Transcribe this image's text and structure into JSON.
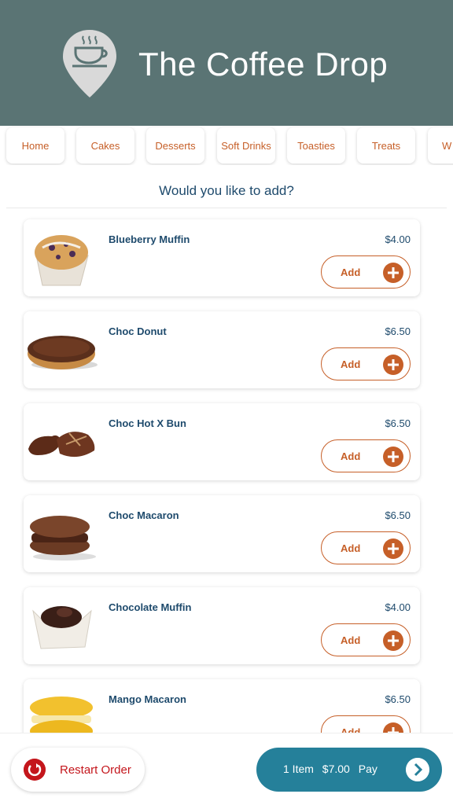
{
  "header": {
    "title": "The Coffee Drop",
    "logo": "coffee-map-pin-logo"
  },
  "tabs": [
    {
      "label": "Home"
    },
    {
      "label": "Cakes"
    },
    {
      "label": "Desserts"
    },
    {
      "label": "Soft Drinks"
    },
    {
      "label": "Toasties"
    },
    {
      "label": "Treats"
    },
    {
      "label": "W"
    }
  ],
  "section": {
    "title": "Would you like to add?"
  },
  "items": [
    {
      "name": "Blueberry Muffin",
      "price": "$4.00",
      "add_label": "Add",
      "image": "blueberry-muffin"
    },
    {
      "name": "Choc Donut",
      "price": "$6.50",
      "add_label": "Add",
      "image": "choc-donut"
    },
    {
      "name": "Choc Hot X Bun",
      "price": "$6.50",
      "add_label": "Add",
      "image": "choc-hot-cross-bun"
    },
    {
      "name": "Choc Macaron",
      "price": "$6.50",
      "add_label": "Add",
      "image": "choc-macaron"
    },
    {
      "name": "Chocolate Muffin",
      "price": "$4.00",
      "add_label": "Add",
      "image": "chocolate-muffin"
    },
    {
      "name": "Mango Macaron",
      "price": "$6.50",
      "add_label": "Add",
      "image": "mango-macaron"
    }
  ],
  "footer": {
    "restart_label": "Restart Order",
    "pay": {
      "items": "1 Item",
      "total": "$7.00",
      "label": "Pay"
    }
  },
  "colors": {
    "header_bg": "#5a7474",
    "accent": "#c65f28",
    "text_dark": "#1e4a6c",
    "pay_bg": "#25809a",
    "restart": "#c4161c"
  }
}
